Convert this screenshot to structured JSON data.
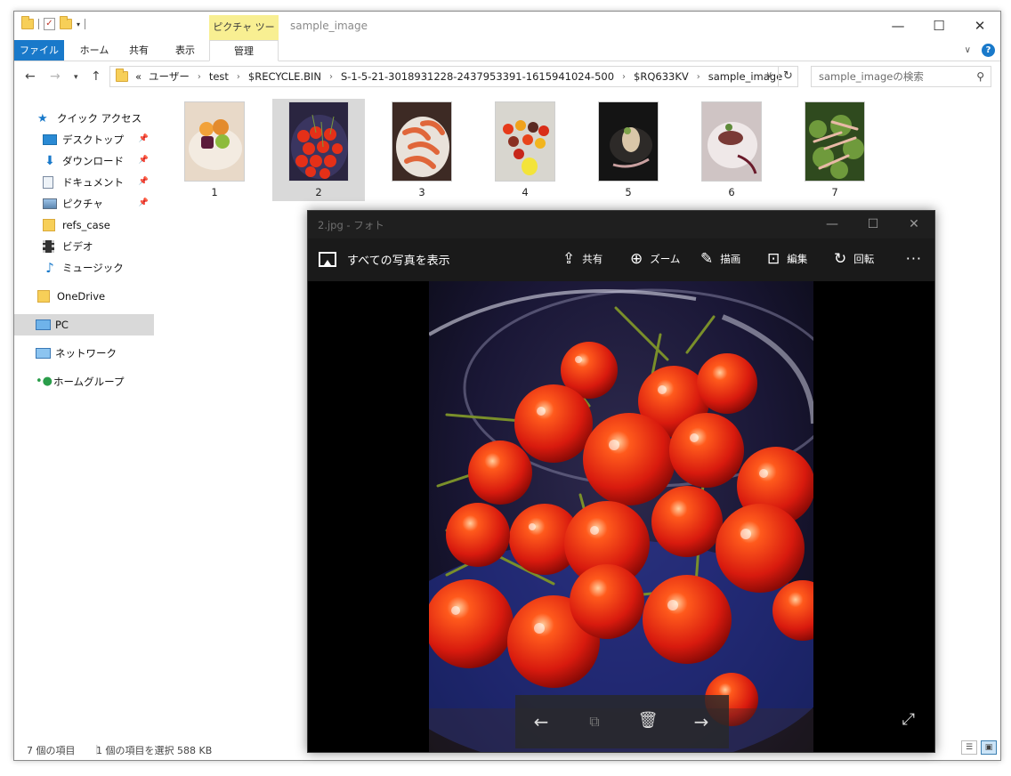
{
  "explorer": {
    "title": "sample_image",
    "context_tab": "ピクチャ ツール",
    "ribbon_tabs": [
      "ファイル",
      "ホーム",
      "共有",
      "表示",
      "管理"
    ],
    "address": {
      "overflow": "«",
      "crumbs": [
        "ユーザー",
        "test",
        "$RECYCLE.BIN",
        "S-1-5-21-3018931228-2437953391-1615941024-500",
        "$RQ633KV",
        "sample_image"
      ]
    },
    "search_placeholder": "sample_imageの検索",
    "nav": {
      "quick_access": "クイック アクセス",
      "desktop": "デスクトップ",
      "downloads": "ダウンロード",
      "documents": "ドキュメント",
      "pictures": "ピクチャ",
      "refs_case": "refs_case",
      "videos": "ビデオ",
      "music": "ミュージック",
      "onedrive": "OneDrive",
      "pc": "PC",
      "network": "ネットワーク",
      "homegroup": "ホームグループ"
    },
    "files": [
      "1",
      "2",
      "3",
      "4",
      "5",
      "6",
      "7"
    ],
    "selected_file": "2",
    "status": {
      "count": "7 個の項目",
      "selection": "1 個の項目を選択  588 KB"
    }
  },
  "photos": {
    "title": "2.jpg - フォト",
    "all_photos": "すべての写真を表示",
    "toolbar": {
      "share": "共有",
      "zoom": "ズーム",
      "draw": "描画",
      "edit": "編集",
      "rotate": "回転",
      "more": "···"
    }
  },
  "icons": {
    "quick_access": "star-icon",
    "pin": "pin-icon",
    "back": "arrow-left-icon",
    "forward": "arrow-right-icon",
    "delete": "trash-icon",
    "slideshow": "slideshow-icon",
    "expand": "expand-icon"
  },
  "colors": {
    "accent": "#1979ca",
    "context_tab": "#f8ef92",
    "selection": "#d9d9d9",
    "photos_bg": "#000000"
  }
}
